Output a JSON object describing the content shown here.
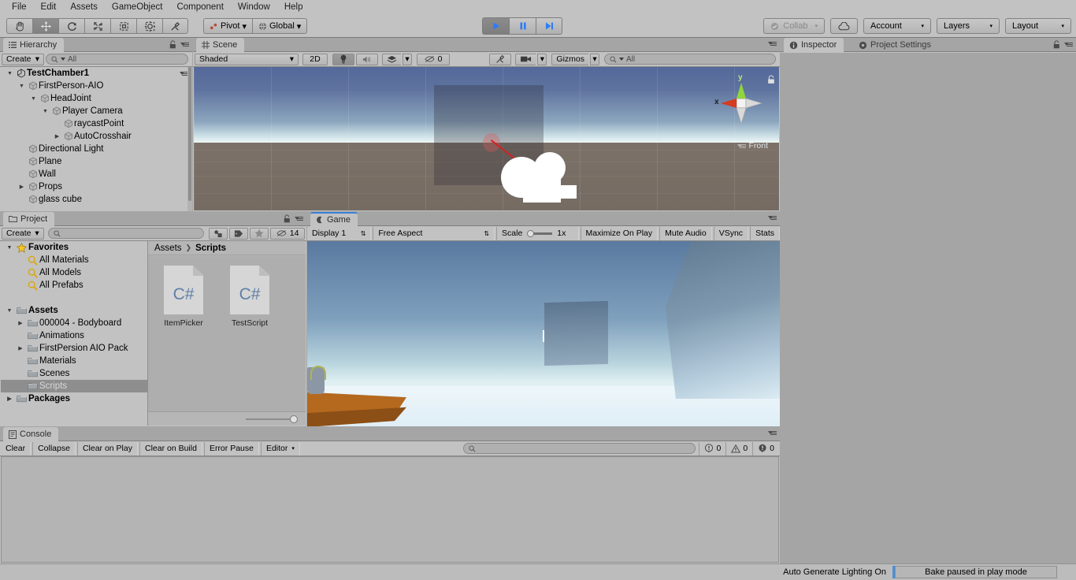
{
  "menubar": {
    "items": [
      "File",
      "Edit",
      "Assets",
      "GameObject",
      "Component",
      "Window",
      "Help"
    ]
  },
  "toolbar": {
    "tools": [
      {
        "name": "hand-tool",
        "icon": "hand-icon",
        "active": false
      },
      {
        "name": "move-tool",
        "icon": "move-icon",
        "active": true
      },
      {
        "name": "rotate-tool",
        "icon": "rotate-icon",
        "active": false
      },
      {
        "name": "scale-tool",
        "icon": "scale-icon",
        "active": false
      },
      {
        "name": "rect-tool",
        "icon": "rect-transform-icon",
        "active": false
      },
      {
        "name": "transform-tool",
        "icon": "transform-icon",
        "active": false
      },
      {
        "name": "custom-tool",
        "icon": "wrench-icon",
        "active": false
      }
    ],
    "pivot_label": "Pivot",
    "global_label": "Global",
    "play_label": "play-icon",
    "pause_label": "pause-icon",
    "step_label": "step-icon",
    "play_active": true,
    "collab_label": "Collab",
    "cloud_label": "cloud-icon",
    "account_label": "Account",
    "layers_label": "Layers",
    "layout_label": "Layout"
  },
  "hierarchy": {
    "tab_label": "Hierarchy",
    "create_label": "Create",
    "search_placeholder": "All",
    "scene_name": "TestChamber1",
    "items": [
      {
        "label": "FirstPerson-AIO",
        "indent": 1,
        "arrow": "down"
      },
      {
        "label": "HeadJoint",
        "indent": 2,
        "arrow": "down"
      },
      {
        "label": "Player Camera",
        "indent": 3,
        "arrow": "down"
      },
      {
        "label": "raycastPoint",
        "indent": 4,
        "arrow": ""
      },
      {
        "label": "AutoCrosshair",
        "indent": 4,
        "arrow": "right"
      },
      {
        "label": "Directional Light",
        "indent": 1,
        "arrow": ""
      },
      {
        "label": "Plane",
        "indent": 1,
        "arrow": ""
      },
      {
        "label": "Wall",
        "indent": 1,
        "arrow": ""
      },
      {
        "label": "Props",
        "indent": 1,
        "arrow": "right"
      },
      {
        "label": "glass cube",
        "indent": 1,
        "arrow": ""
      }
    ]
  },
  "scene": {
    "tab_label": "Scene",
    "shading_mode": "Shaded",
    "mode_2d": "2D",
    "lighting_icon": "lightbulb-icon",
    "audio_icon": "speaker-icon",
    "fx_icon": "effects-icon",
    "hidden_count": "0",
    "tools_icon": "wrench-icon",
    "camera_icon": "camera-icon",
    "gizmos_label": "Gizmos",
    "search_placeholder": "All",
    "gizmo": {
      "axis_x": "x",
      "axis_y": "y",
      "view_label": "Front",
      "x_color": "#d63b1f",
      "y_color": "#8fd63b"
    }
  },
  "inspector": {
    "tab_label": "Inspector",
    "settings_tab_label": "Project Settings"
  },
  "project": {
    "tab_label": "Project",
    "create_label": "Create",
    "search_placeholder": "",
    "hidden_count": "14",
    "tree": [
      {
        "label": "Favorites",
        "indent": 0,
        "arrow": "down",
        "icon": "star-icon",
        "bold": true
      },
      {
        "label": "All Materials",
        "indent": 1,
        "arrow": "",
        "icon": "search-icon",
        "bold": false
      },
      {
        "label": "All Models",
        "indent": 1,
        "arrow": "",
        "icon": "search-icon",
        "bold": false
      },
      {
        "label": "All Prefabs",
        "indent": 1,
        "arrow": "",
        "icon": "search-icon",
        "bold": false
      },
      {
        "label": "",
        "indent": 0,
        "arrow": "",
        "icon": "",
        "bold": false
      },
      {
        "label": "Assets",
        "indent": 0,
        "arrow": "down",
        "icon": "folder-icon",
        "bold": true
      },
      {
        "label": "000004 - Bodyboard",
        "indent": 1,
        "arrow": "right",
        "icon": "folder-icon",
        "bold": false
      },
      {
        "label": "Animations",
        "indent": 1,
        "arrow": "",
        "icon": "folder-icon",
        "bold": false
      },
      {
        "label": "FirstPersion AIO Pack",
        "indent": 1,
        "arrow": "right",
        "icon": "folder-icon",
        "bold": false
      },
      {
        "label": "Materials",
        "indent": 1,
        "arrow": "",
        "icon": "folder-icon",
        "bold": false
      },
      {
        "label": "Scenes",
        "indent": 1,
        "arrow": "",
        "icon": "folder-icon",
        "bold": false
      },
      {
        "label": "Scripts",
        "indent": 1,
        "arrow": "",
        "icon": "folder-icon",
        "bold": false,
        "selected": true
      },
      {
        "label": "Packages",
        "indent": 0,
        "arrow": "right",
        "icon": "folder-icon",
        "bold": true
      }
    ],
    "breadcrumb": [
      "Assets",
      "Scripts"
    ],
    "assets": [
      {
        "label": "ItemPicker",
        "type": "C#"
      },
      {
        "label": "TestScript",
        "type": "C#"
      }
    ]
  },
  "game": {
    "tab_label": "Game",
    "display_label": "Display 1",
    "aspect_label": "Free Aspect",
    "scale_label": "Scale",
    "scale_value": "1x",
    "maximize_label": "Maximize On Play",
    "mute_label": "Mute Audio",
    "vsync_label": "VSync",
    "stats_label": "Stats"
  },
  "console": {
    "tab_label": "Console",
    "clear_label": "Clear",
    "collapse_label": "Collapse",
    "clear_on_play_label": "Clear on Play",
    "clear_on_build_label": "Clear on Build",
    "error_pause_label": "Error Pause",
    "editor_label": "Editor",
    "search_placeholder": "",
    "log_count": "0",
    "warn_count": "0",
    "error_count": "0"
  },
  "statusbar": {
    "lighting_status": "Auto Generate Lighting On",
    "bake_status": "Bake paused in play mode",
    "accent_color": "#4b8fd6"
  }
}
